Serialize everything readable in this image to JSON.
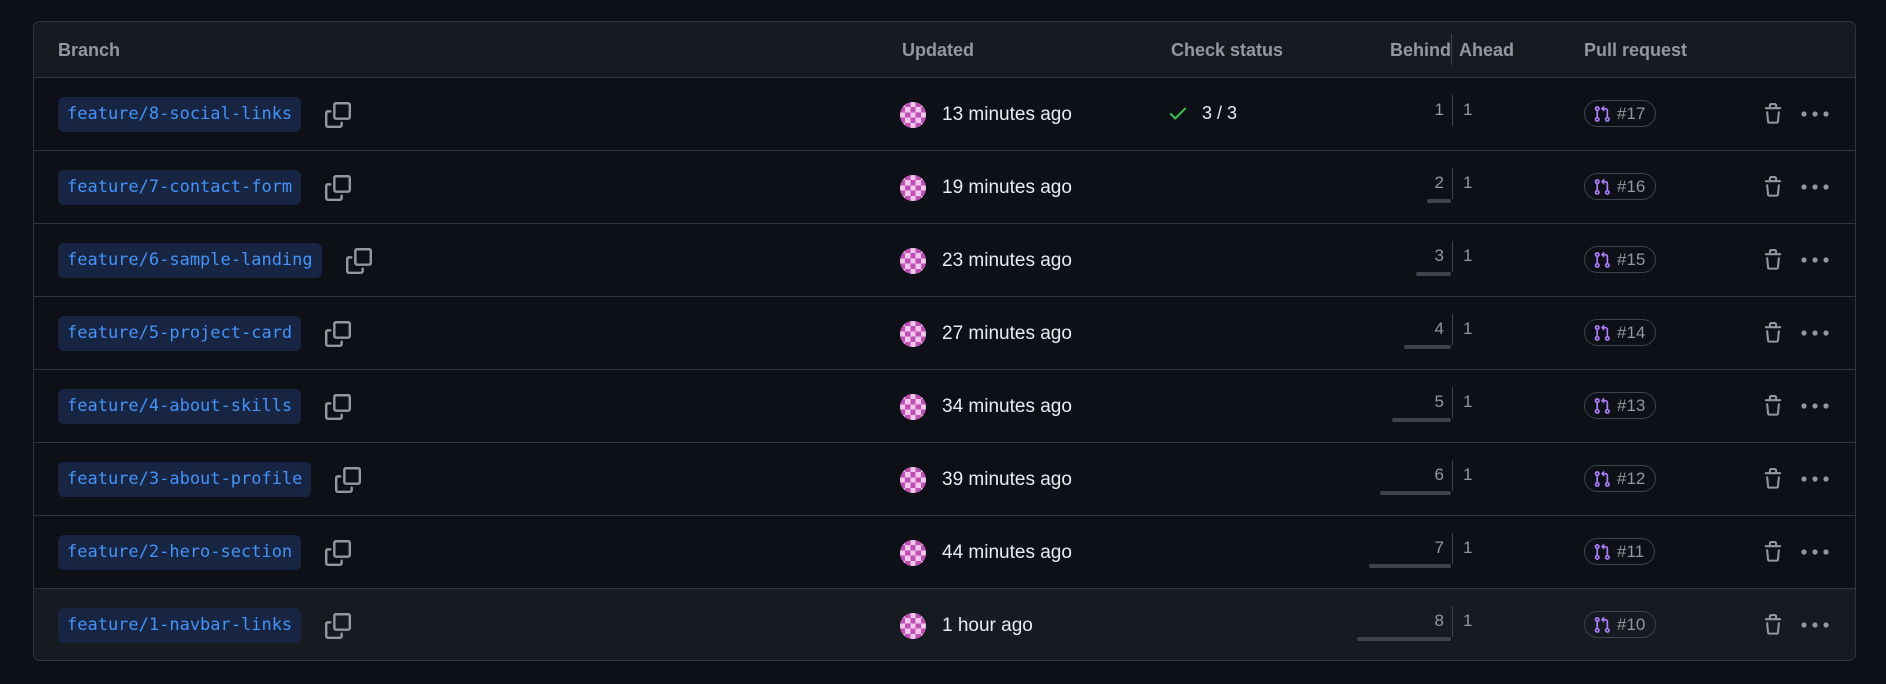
{
  "headers": {
    "branch": "Branch",
    "updated": "Updated",
    "check_status": "Check status",
    "behind": "Behind",
    "ahead": "Ahead",
    "pull_request": "Pull request"
  },
  "colors": {
    "branch_text": "#4493f8",
    "branch_bg": "#172542",
    "check_green": "#3fb950",
    "pr_icon": "#ab7df8",
    "avatar_a": "#c24fb6",
    "avatar_b": "#f0c8ec"
  },
  "rows": [
    {
      "branch": "feature/8-social-links",
      "updated": "13 minutes ago",
      "check": "3 / 3",
      "behind": "1",
      "ahead": "1",
      "pr": "#17"
    },
    {
      "branch": "feature/7-contact-form",
      "updated": "19 minutes ago",
      "check": "",
      "behind": "2",
      "ahead": "1",
      "pr": "#16"
    },
    {
      "branch": "feature/6-sample-landing",
      "updated": "23 minutes ago",
      "check": "",
      "behind": "3",
      "ahead": "1",
      "pr": "#15"
    },
    {
      "branch": "feature/5-project-card",
      "updated": "27 minutes ago",
      "check": "",
      "behind": "4",
      "ahead": "1",
      "pr": "#14"
    },
    {
      "branch": "feature/4-about-skills",
      "updated": "34 minutes ago",
      "check": "",
      "behind": "5",
      "ahead": "1",
      "pr": "#13"
    },
    {
      "branch": "feature/3-about-profile",
      "updated": "39 minutes ago",
      "check": "",
      "behind": "6",
      "ahead": "1",
      "pr": "#12"
    },
    {
      "branch": "feature/2-hero-section",
      "updated": "44 minutes ago",
      "check": "",
      "behind": "7",
      "ahead": "1",
      "pr": "#11"
    },
    {
      "branch": "feature/1-navbar-links",
      "updated": "1 hour ago",
      "check": "",
      "behind": "8",
      "ahead": "1",
      "pr": "#10"
    }
  ]
}
